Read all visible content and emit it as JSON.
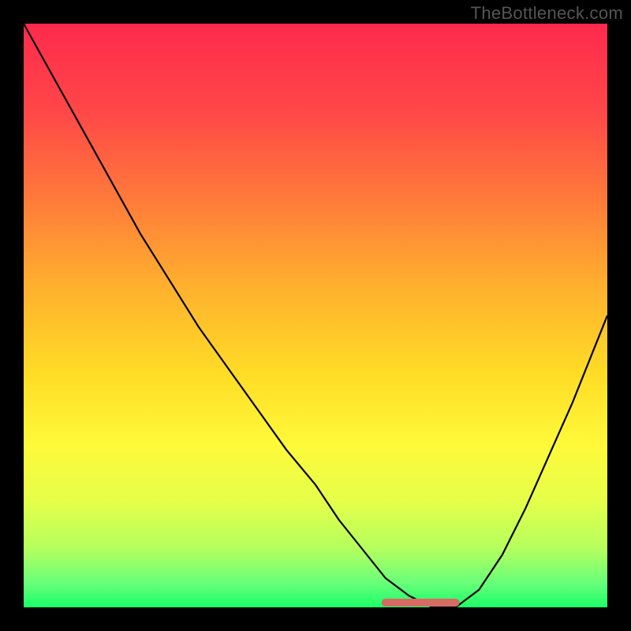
{
  "watermark": "TheBottleneck.com",
  "colors": {
    "frame_bg": "#000000",
    "curve": "#000000",
    "accent": "#d66b63",
    "watermark": "#555555",
    "gradient_stops": [
      {
        "offset": 0.0,
        "color": "#ff2a4d"
      },
      {
        "offset": 0.15,
        "color": "#ff4748"
      },
      {
        "offset": 0.3,
        "color": "#ff7a3a"
      },
      {
        "offset": 0.45,
        "color": "#ffb02e"
      },
      {
        "offset": 0.6,
        "color": "#ffdc26"
      },
      {
        "offset": 0.72,
        "color": "#fff93a"
      },
      {
        "offset": 0.82,
        "color": "#e4ff4a"
      },
      {
        "offset": 0.9,
        "color": "#b4ff5e"
      },
      {
        "offset": 0.96,
        "color": "#66ff7a"
      },
      {
        "offset": 1.0,
        "color": "#1aff66"
      }
    ]
  },
  "chart_data": {
    "type": "line",
    "title": "",
    "xlabel": "",
    "ylabel": "",
    "xlim": [
      0,
      100
    ],
    "ylim": [
      0,
      100
    ],
    "note": "x and y are in percent of the inner plot area; y=0 is the bottom (green), y=100 is the top (red). Curve shows bottleneck mismatch vs. a parameter; minimum ≈ best balance.",
    "series": [
      {
        "name": "bottleneck-curve",
        "x": [
          0,
          5,
          10,
          15,
          20,
          25,
          30,
          35,
          40,
          45,
          50,
          54,
          58,
          62,
          66,
          70,
          74,
          78,
          82,
          86,
          90,
          94,
          100
        ],
        "y": [
          100,
          91,
          82,
          73,
          64,
          56,
          48,
          41,
          34,
          27,
          21,
          15,
          10,
          5,
          2,
          0,
          0,
          3,
          9,
          17,
          26,
          35,
          50
        ]
      }
    ],
    "flat_minimum": {
      "x_start": 62,
      "x_end": 74,
      "y": 0
    }
  }
}
